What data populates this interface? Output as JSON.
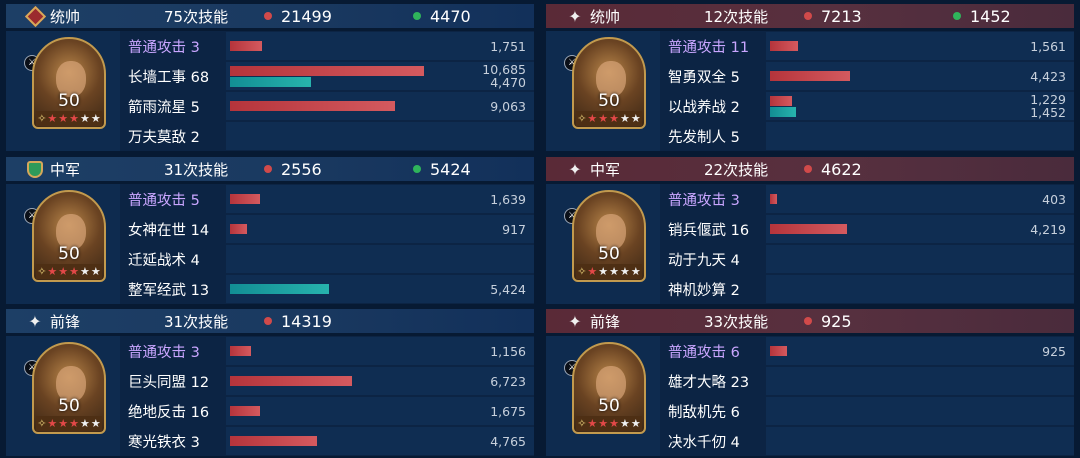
{
  "left": [
    {
      "role": "统帅",
      "count": "75次技能",
      "damage": "21499",
      "heal": "4470",
      "badge": "diamond",
      "level": "50",
      "stars": [
        "orange",
        "red",
        "red",
        "red",
        "white",
        "white"
      ],
      "skills": [
        {
          "name": "普通攻击",
          "num": "3",
          "purple": true,
          "red": 1751,
          "redText": "1,751"
        },
        {
          "name": "长墙工事",
          "num": "68",
          "red": 10685,
          "redText": "10,685",
          "teal": 4470,
          "tealText": "4,470"
        },
        {
          "name": "箭雨流星",
          "num": "5",
          "red": 9063,
          "redText": "9,063"
        },
        {
          "name": "万夫莫敌",
          "num": "2"
        }
      ]
    },
    {
      "role": "中军",
      "count": "31次技能",
      "damage": "2556",
      "heal": "5424",
      "badge": "shield",
      "level": "50",
      "stars": [
        "orange",
        "red",
        "red",
        "red",
        "white",
        "white"
      ],
      "skills": [
        {
          "name": "普通攻击",
          "num": "5",
          "purple": true,
          "red": 1639,
          "redText": "1,639"
        },
        {
          "name": "女神在世",
          "num": "14",
          "red": 917,
          "redText": "917"
        },
        {
          "name": "迁延战术",
          "num": "4"
        },
        {
          "name": "整军经武",
          "num": "13",
          "teal": 5424,
          "tealText": "5,424"
        }
      ]
    },
    {
      "role": "前锋",
      "count": "31次技能",
      "damage": "14319",
      "heal": null,
      "badge": "spark",
      "level": "50",
      "stars": [
        "orange",
        "red",
        "red",
        "red",
        "white",
        "white"
      ],
      "skills": [
        {
          "name": "普通攻击",
          "num": "3",
          "purple": true,
          "red": 1156,
          "redText": "1,156"
        },
        {
          "name": "巨头同盟",
          "num": "12",
          "red": 6723,
          "redText": "6,723"
        },
        {
          "name": "绝地反击",
          "num": "16",
          "red": 1675,
          "redText": "1,675"
        },
        {
          "name": "寒光铁衣",
          "num": "3",
          "red": 4765,
          "redText": "4,765"
        }
      ]
    }
  ],
  "right": [
    {
      "role": "统帅",
      "count": "12次技能",
      "damage": "7213",
      "heal": "1452",
      "badge": "spark",
      "level": "50",
      "stars": [
        "orange",
        "red",
        "red",
        "red",
        "white",
        "white"
      ],
      "skills": [
        {
          "name": "普通攻击",
          "num": "11",
          "purple": true,
          "red": 1561,
          "redText": "1,561"
        },
        {
          "name": "智勇双全",
          "num": "5",
          "red": 4423,
          "redText": "4,423"
        },
        {
          "name": "以战养战",
          "num": "2",
          "red": 1229,
          "redText": "1,229",
          "teal": 1452,
          "tealText": "1,452"
        },
        {
          "name": "先发制人",
          "num": "5"
        }
      ]
    },
    {
      "role": "中军",
      "count": "22次技能",
      "damage": "4622",
      "heal": null,
      "badge": "spark",
      "level": "50",
      "stars": [
        "orange",
        "red",
        "white",
        "white",
        "white",
        "white"
      ],
      "skills": [
        {
          "name": "普通攻击",
          "num": "3",
          "purple": true,
          "red": 403,
          "redText": "403"
        },
        {
          "name": "销兵偃武",
          "num": "16",
          "red": 4219,
          "redText": "4,219"
        },
        {
          "name": "动于九天",
          "num": "4"
        },
        {
          "name": "神机妙算",
          "num": "2"
        }
      ]
    },
    {
      "role": "前锋",
      "count": "33次技能",
      "damage": "925",
      "heal": null,
      "badge": "spark",
      "level": "50",
      "stars": [
        "orange",
        "red",
        "red",
        "red",
        "white",
        "white"
      ],
      "skills": [
        {
          "name": "普通攻击",
          "num": "6",
          "purple": true,
          "red": 925,
          "redText": "925"
        },
        {
          "name": "雄才大略",
          "num": "23"
        },
        {
          "name": "制敌机先",
          "num": "6"
        },
        {
          "name": "决水千仞",
          "num": "4"
        }
      ]
    }
  ]
}
